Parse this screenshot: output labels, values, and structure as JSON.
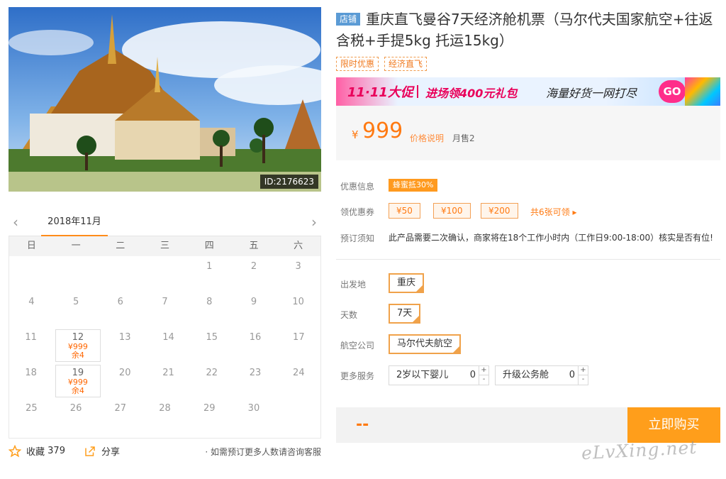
{
  "photo": {
    "id_label": "ID:2176623"
  },
  "calendar": {
    "month_label": "2018年11月",
    "weekdays": [
      "日",
      "一",
      "二",
      "三",
      "四",
      "五",
      "六"
    ],
    "weeks": [
      [
        {
          "d": ""
        },
        {
          "d": ""
        },
        {
          "d": ""
        },
        {
          "d": ""
        },
        {
          "d": "1"
        },
        {
          "d": "2"
        },
        {
          "d": "3"
        }
      ],
      [
        {
          "d": "4"
        },
        {
          "d": "5"
        },
        {
          "d": "6"
        },
        {
          "d": "7"
        },
        {
          "d": "8"
        },
        {
          "d": "9"
        },
        {
          "d": "10"
        }
      ],
      [
        {
          "d": "11"
        },
        {
          "d": "12",
          "price": "¥999",
          "left": "余4"
        },
        {
          "d": "13"
        },
        {
          "d": "14"
        },
        {
          "d": "15"
        },
        {
          "d": "16"
        },
        {
          "d": "17"
        }
      ],
      [
        {
          "d": "18"
        },
        {
          "d": "19",
          "price": "¥999",
          "left": "余4"
        },
        {
          "d": "20"
        },
        {
          "d": "21"
        },
        {
          "d": "22"
        },
        {
          "d": "23"
        },
        {
          "d": "24"
        }
      ],
      [
        {
          "d": "25"
        },
        {
          "d": "26"
        },
        {
          "d": "27"
        },
        {
          "d": "28"
        },
        {
          "d": "29"
        },
        {
          "d": "30"
        },
        {
          "d": ""
        }
      ]
    ]
  },
  "actions": {
    "favorite_label": "收藏",
    "favorite_count": "379",
    "share_label": "分享",
    "contact_note": "· 如需预订更多人数请咨询客服"
  },
  "product": {
    "store_badge": "店铺",
    "title": "重庆直飞曼谷7天经济舱机票（马尔代夫国家航空+往返含税+手提5kg 托运15kg）",
    "tags": [
      "限时优惠",
      "经济直飞"
    ]
  },
  "banner": {
    "event": "11·11大促",
    "gift": "进场领400元礼包",
    "slogan": "海量好货一网打尽",
    "go": "GO"
  },
  "price": {
    "symbol": "¥",
    "value": "999",
    "note": "价格说明",
    "sold": "月售2"
  },
  "promo": {
    "label": "优惠信息",
    "badge": "蜂蜜抵30%"
  },
  "coupons": {
    "label": "领优惠券",
    "items": [
      "¥50",
      "¥100",
      "¥200"
    ],
    "more": "共6张可领 ▸"
  },
  "booking": {
    "label": "预订须知",
    "text": "此产品需要二次确认，商家将在18个工作小时内（工作日9:00-18:00）核实是否有位!"
  },
  "options": {
    "departure_label": "出发地",
    "departure_value": "重庆",
    "days_label": "天数",
    "days_value": "7天",
    "airline_label": "航空公司",
    "airline_value": "马尔代夫航空"
  },
  "services": {
    "label": "更多服务",
    "items": [
      {
        "name": "2岁以下婴儿",
        "qty": "0",
        "plus": "+",
        "minus": "-"
      },
      {
        "name": "升级公务舱",
        "qty": "0",
        "plus": "+",
        "minus": "-"
      }
    ]
  },
  "purchase": {
    "total": "--",
    "buy_label": "立即购买"
  },
  "watermark": "eLvXing.net",
  "colors": {
    "accent": "#ff7a12",
    "buy_button": "#ff9e1b",
    "store_badge": "#5b9bd5"
  }
}
